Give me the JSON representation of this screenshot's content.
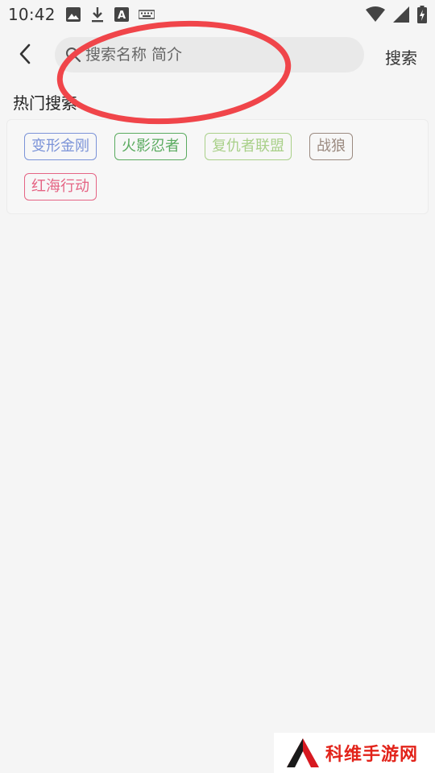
{
  "status_bar": {
    "time": "10:42",
    "left_icons": [
      "image-icon",
      "download-icon",
      "a-box-icon",
      "keyboard-icon"
    ],
    "right_icons": [
      "wifi-icon",
      "signal-icon",
      "battery-icon"
    ]
  },
  "top_bar": {
    "back_icon": "chevron-left-icon",
    "search_placeholder": "搜索名称 简介",
    "search_button_label": "搜索"
  },
  "hot_search": {
    "title": "热门搜索",
    "tags": [
      {
        "label": "变形金刚",
        "color": "#7b93d8"
      },
      {
        "label": "火影忍者",
        "color": "#5aab5f"
      },
      {
        "label": "复仇者联盟",
        "color": "#a9d089"
      },
      {
        "label": "战狼",
        "color": "#9b8a80"
      },
      {
        "label": "红海行动",
        "color": "#e56484"
      }
    ]
  },
  "annotation": {
    "color": "#f0454a"
  },
  "watermark": {
    "text": "科维手游网",
    "text_color": "#e2231a"
  }
}
